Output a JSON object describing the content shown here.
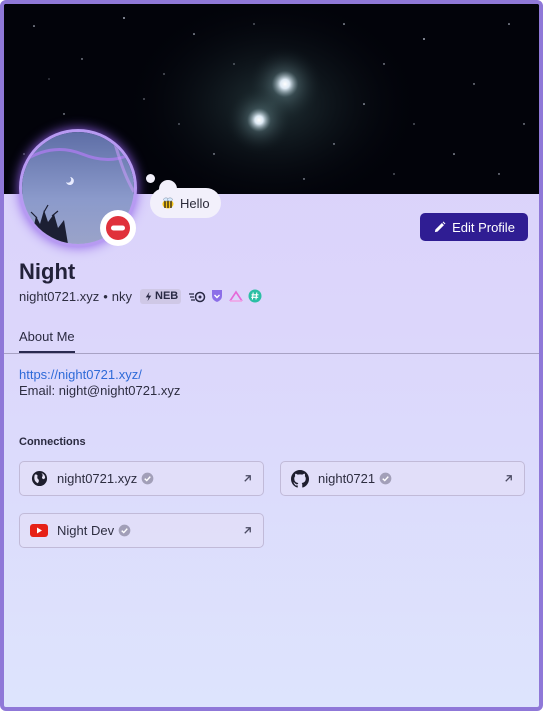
{
  "profile": {
    "display_name": "Night",
    "username": "night0721.xyz",
    "separator": "•",
    "pronoun_tag": "nky",
    "status_text": "Hello",
    "status_emoji": "bee-emoji",
    "badges": [
      "neb-badge",
      "speed-badge",
      "shield-badge",
      "triangle-badge",
      "hashtag-badge"
    ],
    "badge_neb_label": "NEB"
  },
  "actions": {
    "edit_profile": "Edit Profile"
  },
  "tabs": [
    {
      "label": "About Me",
      "active": true
    }
  ],
  "about": {
    "link": "https://night0721.xyz/",
    "email_line": "Email: night@night0721.xyz"
  },
  "connections": {
    "title": "Connections",
    "items": [
      {
        "name": "night0721.xyz",
        "icon": "globe-icon",
        "verified": true
      },
      {
        "name": "night0721",
        "icon": "github-icon",
        "verified": true
      },
      {
        "name": "Night Dev",
        "icon": "youtube-icon",
        "verified": true
      }
    ]
  },
  "colors": {
    "accent": "#2f1d93",
    "link": "#2f6bd8",
    "frame_border": "#8f78d8",
    "dnd_status": "#e0313b",
    "youtube": "#e62117"
  }
}
